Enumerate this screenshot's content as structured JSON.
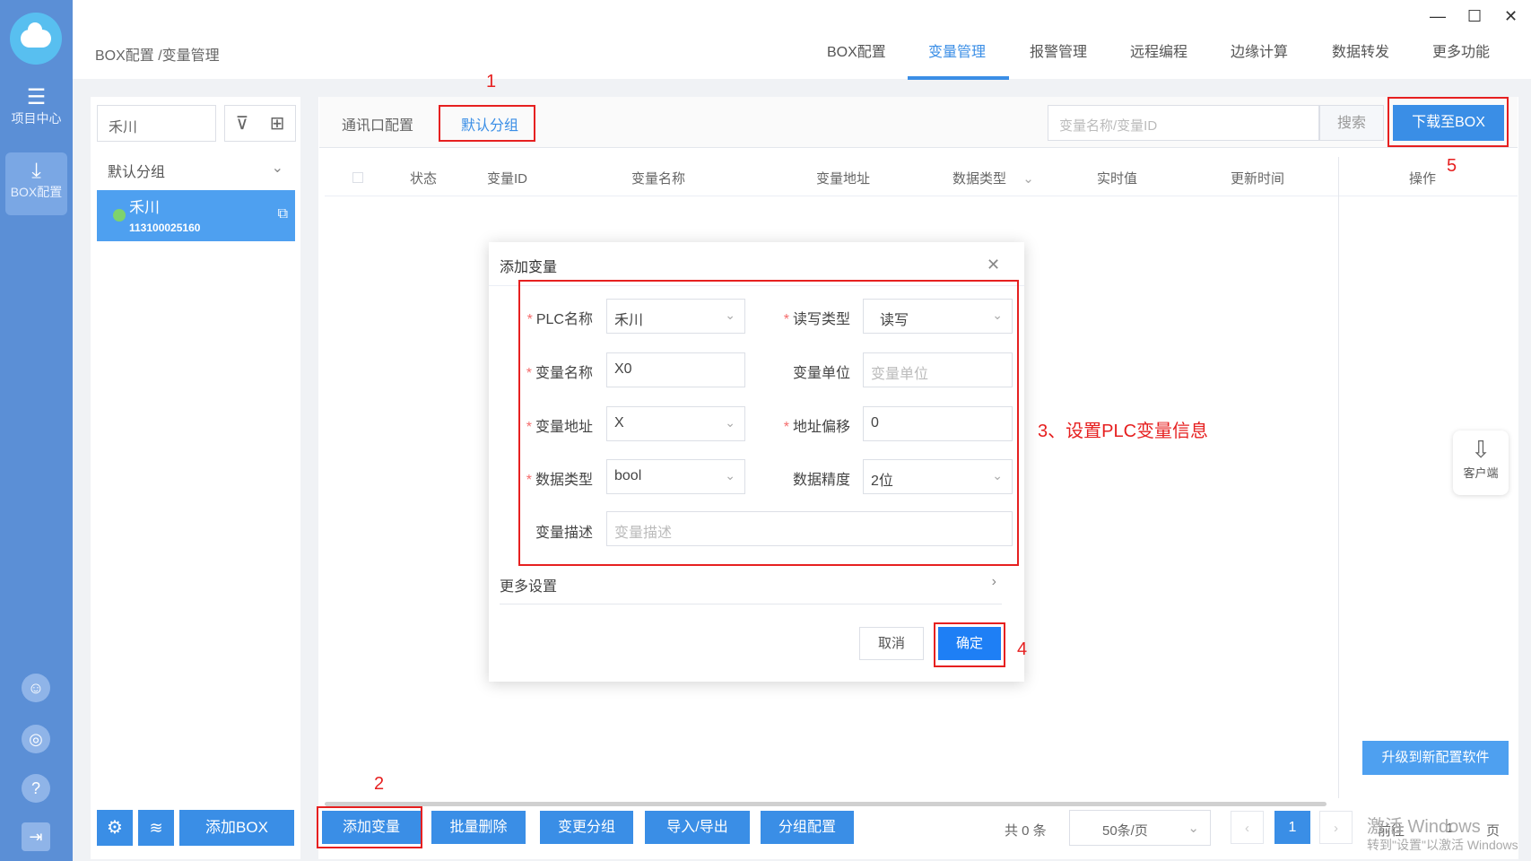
{
  "sidebar": {
    "items": [
      {
        "label": "项目中心",
        "icon": "grid-icon"
      },
      {
        "label": "BOX配置",
        "icon": "download-icon"
      }
    ]
  },
  "header": {
    "breadcrumb": "BOX配置 /变量管理",
    "tabs": [
      "BOX配置",
      "变量管理",
      "报警管理",
      "远程编程",
      "边缘计算",
      "数据转发",
      "更多功能"
    ],
    "active_tab": "变量管理"
  },
  "left_panel": {
    "search_value": "禾川",
    "group_label": "默认分组",
    "device": {
      "name": "禾川",
      "id": "113100025160",
      "status_color": "#7ed36b"
    },
    "add_box_label": "添加BOX"
  },
  "subtabs": [
    "通讯口配置",
    "默认分组"
  ],
  "var_search": {
    "placeholder": "变量名称/变量ID",
    "button": "搜索"
  },
  "download_button": "下载至BOX",
  "table": {
    "columns": [
      "状态",
      "变量ID",
      "变量名称",
      "变量地址",
      "数据类型",
      "实时值",
      "更新时间",
      "操作"
    ]
  },
  "dialog": {
    "title": "添加变量",
    "fields": {
      "plc_name": {
        "label": "PLC名称",
        "value": "禾川"
      },
      "rw_type": {
        "label": "读写类型",
        "value": "读写"
      },
      "var_name": {
        "label": "变量名称",
        "value": "X0"
      },
      "var_unit": {
        "label": "变量单位",
        "placeholder": "变量单位"
      },
      "var_addr": {
        "label": "变量地址",
        "value": "X"
      },
      "addr_offset": {
        "label": "地址偏移",
        "value": "0"
      },
      "data_type": {
        "label": "数据类型",
        "value": "bool"
      },
      "precision": {
        "label": "数据精度",
        "value": "2位"
      },
      "desc": {
        "label": "变量描述",
        "placeholder": "变量描述"
      }
    },
    "more_settings": "更多设置",
    "cancel": "取消",
    "ok": "确定"
  },
  "bottom_bar": {
    "buttons": [
      "添加变量",
      "批量删除",
      "变更分组",
      "导入/导出",
      "分组配置"
    ],
    "total": "共 0 条",
    "page_size": "50条/页",
    "current_page": "1",
    "goto_prefix": "前往",
    "goto_value": "1",
    "goto_suffix": "页"
  },
  "client_float": "客户端",
  "upgrade_button": "升级到新配置软件",
  "watermark": {
    "line1": "激活 Windows",
    "line2": "转到\"设置\"以激活 Windows"
  },
  "annotations": {
    "a1": "1",
    "a2": "2",
    "a3": "3、设置PLC变量信息",
    "a4": "4",
    "a5": "5"
  },
  "colors": {
    "primary": "#3a8ee6",
    "sidebar": "#5b8fd6",
    "annotation": "#e62020"
  }
}
